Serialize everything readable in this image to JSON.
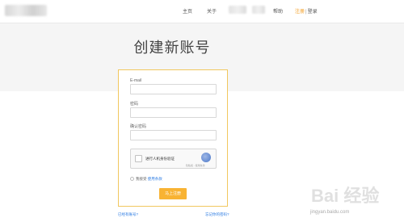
{
  "nav": {
    "home": "主页",
    "about": "关于",
    "help": "帮助",
    "register": "注册",
    "separator": "|",
    "login": "登录"
  },
  "page": {
    "title": "创建新账号"
  },
  "form": {
    "email_label": "E-mail",
    "password_label": "密码",
    "confirm_label": "确认密码",
    "email_value": "",
    "password_value": "",
    "confirm_value": "",
    "captcha_text": "进行人机身份验证",
    "captcha_meta": "隐私权 - 使用条款",
    "agree_text": "我接受",
    "terms_link": "使用条款",
    "submit_label": "马上注册"
  },
  "footer_links": {
    "have_account": "已经有账号?",
    "forgot_password": "忘记你的密码?"
  },
  "watermark": {
    "text": "jingyan.baidu.com",
    "brand": "Bai 经验"
  },
  "colors": {
    "accent": "#f8b333",
    "card_border": "#f1c75e",
    "link": "#2a7ae2",
    "register_link": "#f39c1f"
  }
}
